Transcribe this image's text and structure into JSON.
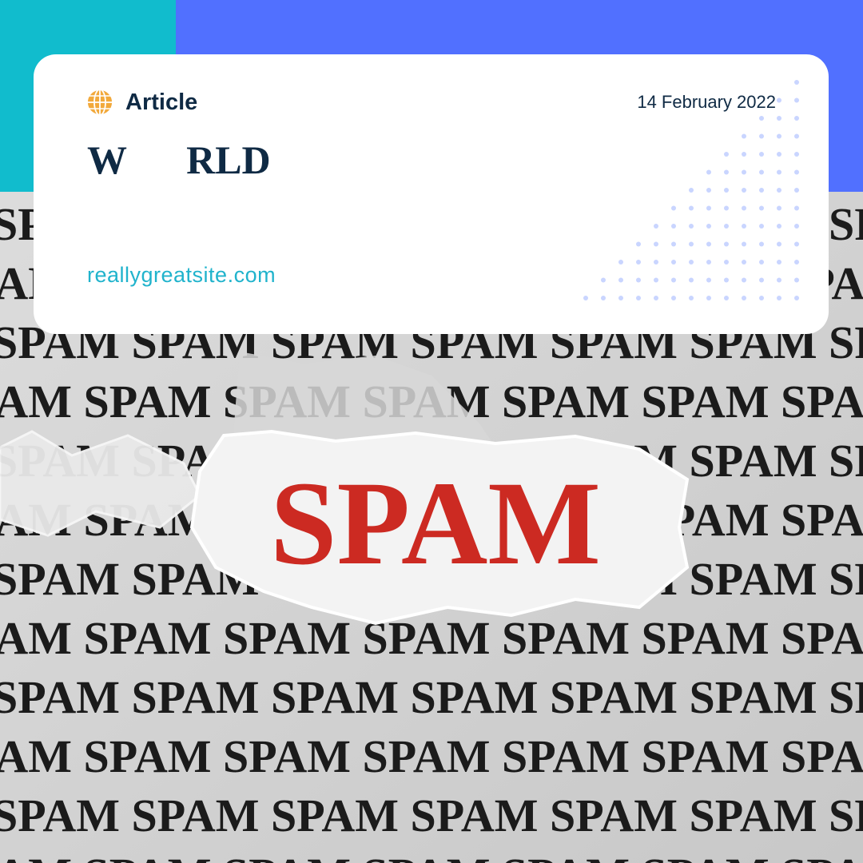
{
  "colors": {
    "teal": "#11bccd",
    "blue": "#5170ff",
    "navy": "#0f2a44",
    "link": "#20b3cc",
    "globe": "#f2a93b",
    "spam_red": "#cc2a22",
    "dots": "#c9d5ff"
  },
  "header": {
    "category_icon": "globe-icon",
    "category": "Article",
    "date": "14 February 2022",
    "section_title": "W      RLD"
  },
  "footer": {
    "website": "reallygreatsite.com"
  },
  "photo": {
    "headline": "SPAM",
    "pattern_word": "SPAM"
  }
}
